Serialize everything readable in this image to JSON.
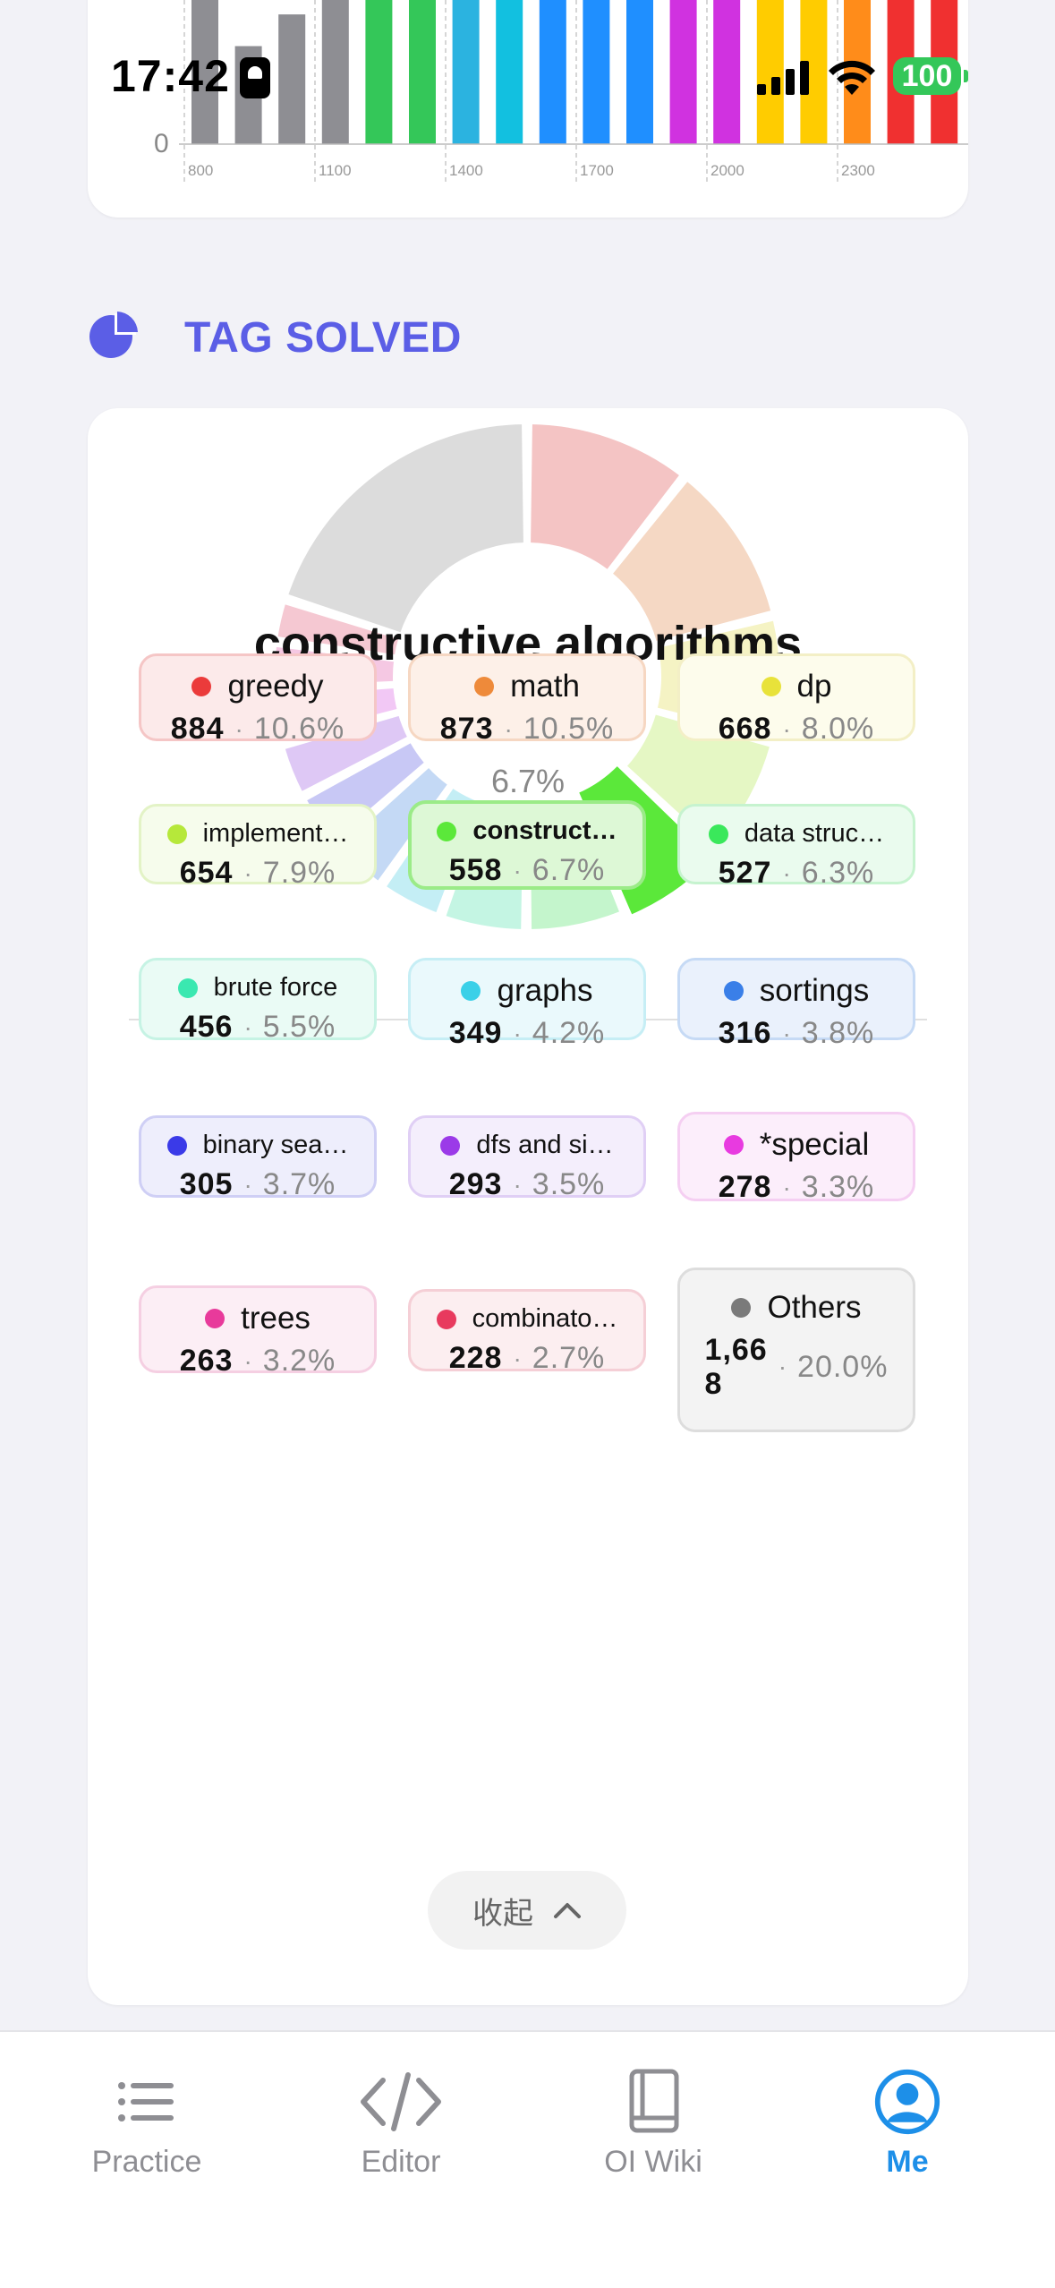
{
  "status_bar": {
    "time": "17:42",
    "battery": "100"
  },
  "rating_chart": {
    "y_zero_label": "0",
    "x_ticks": [
      "800",
      "1100",
      "1400",
      "1700",
      "2000",
      "2300"
    ],
    "bar_colors": [
      "#8E8E93",
      "#8E8E93",
      "#8E8E93",
      "#8E8E93",
      "#34C759",
      "#34C759",
      "#2BB3E0",
      "#12C0E0",
      "#1F8FFF",
      "#1F8FFF",
      "#1F8FFF",
      "#D032E0",
      "#D032E0",
      "#FFCC00",
      "#FFCC00",
      "#FF8C1A",
      "#F03030",
      "#F03030"
    ],
    "bar_heights_pct": [
      100,
      68,
      90,
      100,
      100,
      100,
      100,
      100,
      100,
      100,
      100,
      100,
      100,
      100,
      100,
      100,
      100,
      100
    ]
  },
  "section": {
    "title": "TAG SOLVED",
    "icon": "pie-chart-icon"
  },
  "donut": {
    "selected_name": "constructive algorithms",
    "selected_value": "558",
    "selected_pct": "6.7%"
  },
  "chart_data": {
    "type": "pie",
    "title": "TAG SOLVED",
    "categories": [
      "greedy",
      "math",
      "dp",
      "implementation",
      "constructive algorithms",
      "data structures",
      "brute force",
      "graphs",
      "sortings",
      "binary search",
      "dfs and similar",
      "*special",
      "trees",
      "combinatorics",
      "Others"
    ],
    "values": [
      884,
      873,
      668,
      654,
      558,
      527,
      456,
      349,
      316,
      305,
      293,
      278,
      263,
      228,
      1668
    ],
    "percents": [
      10.6,
      10.5,
      8.0,
      7.9,
      6.7,
      6.3,
      5.5,
      4.2,
      3.8,
      3.7,
      3.5,
      3.3,
      3.2,
      2.7,
      20.0
    ],
    "selected": "constructive algorithms"
  },
  "legend": [
    {
      "name": "greedy",
      "count": "884",
      "pct": "10.6%",
      "color": "#EB3B3B",
      "bg": "#FCEAEA",
      "border": "#F5C6C6"
    },
    {
      "name": "math",
      "count": "873",
      "pct": "10.5%",
      "color": "#EE8A3A",
      "bg": "#FDF0E8",
      "border": "#F6D7C2"
    },
    {
      "name": "dp",
      "count": "668",
      "pct": "8.0%",
      "color": "#E8E23A",
      "bg": "#FDFCEC",
      "border": "#F3EFC6"
    },
    {
      "name": "implement…",
      "count": "654",
      "pct": "7.9%",
      "color": "#B6E83A",
      "bg": "#F6FCEC",
      "border": "#E3F3C6"
    },
    {
      "name": "construct…",
      "count": "558",
      "pct": "6.7%",
      "color": "#5BE83A",
      "bg": "#DDF8D6",
      "border": "#9BEB88"
    },
    {
      "name": "data struc…",
      "count": "527",
      "pct": "6.3%",
      "color": "#3AE85B",
      "bg": "#EAFBEE",
      "border": "#C6F3CF"
    },
    {
      "name": "brute force",
      "count": "456",
      "pct": "5.5%",
      "color": "#3AE8B0",
      "bg": "#EAFBF5",
      "border": "#C6F3E4"
    },
    {
      "name": "graphs",
      "count": "349",
      "pct": "4.2%",
      "color": "#3AD0E8",
      "bg": "#EAF9FC",
      "border": "#C6EEF5"
    },
    {
      "name": "sortings",
      "count": "316",
      "pct": "3.8%",
      "color": "#3A7FE8",
      "bg": "#EAF1FC",
      "border": "#C6DAF5"
    },
    {
      "name": "binary sea…",
      "count": "305",
      "pct": "3.7%",
      "color": "#3A3AE8",
      "bg": "#EEEEFC",
      "border": "#CFCFF5"
    },
    {
      "name": "dfs and si…",
      "count": "293",
      "pct": "3.5%",
      "color": "#9B3AE8",
      "bg": "#F4EEFC",
      "border": "#E0CFF5"
    },
    {
      "name": "*special",
      "count": "278",
      "pct": "3.3%",
      "color": "#E83AE0",
      "bg": "#FCEEFB",
      "border": "#F5CFF2"
    },
    {
      "name": "trees",
      "count": "263",
      "pct": "3.2%",
      "color": "#E83A9B",
      "bg": "#FCEEF5",
      "border": "#F5CFE2"
    },
    {
      "name": "combinato…",
      "count": "228",
      "pct": "2.7%",
      "color": "#E83A5E",
      "bg": "#FCEEF0",
      "border": "#F5CFD6"
    },
    {
      "name": "Others",
      "count": "1,668",
      "count_line1": "1,66",
      "count_line2": "8",
      "pct": "20.0%",
      "color": "#7A7A7A",
      "bg": "#F3F3F3",
      "border": "#DDDDDD"
    }
  ],
  "collapse_label": "收起",
  "tabs": [
    {
      "label": "Practice",
      "icon": "list-icon",
      "active": false
    },
    {
      "label": "Editor",
      "icon": "code-icon",
      "active": false
    },
    {
      "label": "OI Wiki",
      "icon": "book-icon",
      "active": false
    },
    {
      "label": "Me",
      "icon": "person-icon",
      "active": true
    }
  ]
}
